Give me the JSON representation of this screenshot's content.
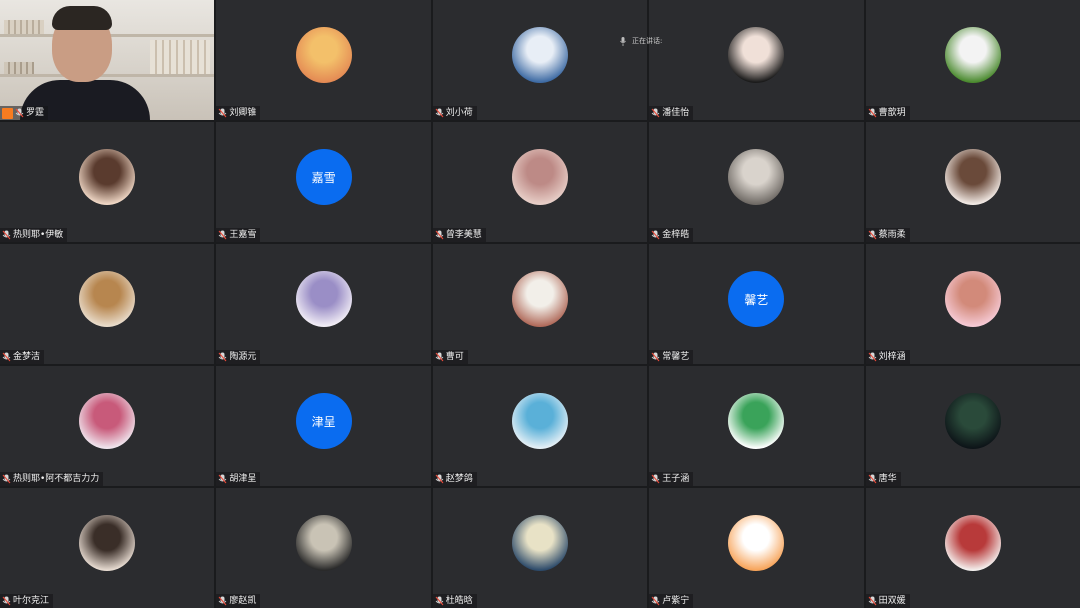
{
  "meeting": {
    "speaking_label": "正在讲话:"
  },
  "participants": [
    {
      "name": "罗霆",
      "type": "video",
      "host": true
    },
    {
      "name": "刘卿锥",
      "type": "image",
      "colors": [
        "#e48a54",
        "#f3c06a"
      ]
    },
    {
      "name": "刘小荷",
      "type": "image",
      "colors": [
        "#3d6aa3",
        "#e8eef6"
      ]
    },
    {
      "name": "潘佳怡",
      "type": "image",
      "colors": [
        "#1b1b1b",
        "#f0e0d8"
      ]
    },
    {
      "name": "曹歆玥",
      "type": "image",
      "colors": [
        "#4a8a2e",
        "#f3f3f3"
      ]
    },
    {
      "name": "热则耶•伊敏",
      "type": "image",
      "colors": [
        "#f0d8c6",
        "#5a3b2e"
      ]
    },
    {
      "name": "王嘉雪",
      "type": "text",
      "initials": "嘉雪",
      "bg": "#0a6cf0"
    },
    {
      "name": "曾李美慧",
      "type": "image",
      "colors": [
        "#e8cfc8",
        "#bd8a86"
      ]
    },
    {
      "name": "金梓皓",
      "type": "image",
      "colors": [
        "#6f6a65",
        "#d9d3cc"
      ]
    },
    {
      "name": "蔡雨柔",
      "type": "image",
      "colors": [
        "#f3ebe6",
        "#6a4a3a"
      ]
    },
    {
      "name": "金梦洁",
      "type": "image",
      "colors": [
        "#e9dccb",
        "#b7864f"
      ]
    },
    {
      "name": "陶源元",
      "type": "image",
      "colors": [
        "#f2eef6",
        "#9a8ec6"
      ]
    },
    {
      "name": "曹可",
      "type": "image",
      "colors": [
        "#b06a5a",
        "#f2efe9"
      ]
    },
    {
      "name": "常馨艺",
      "type": "text",
      "initials": "馨艺",
      "bg": "#0a6cf0"
    },
    {
      "name": "刘梓涵",
      "type": "image",
      "colors": [
        "#f6cad5",
        "#d28a7a"
      ]
    },
    {
      "name": "热则耶•阿不都吉力力",
      "type": "image",
      "colors": [
        "#f0e6ee",
        "#c85a7a"
      ]
    },
    {
      "name": "胡津呈",
      "type": "text",
      "initials": "津呈",
      "bg": "#0a6cf0"
    },
    {
      "name": "赵梦鸽",
      "type": "image",
      "colors": [
        "#e6f0f6",
        "#5ab0d8"
      ]
    },
    {
      "name": "王子涵",
      "type": "image",
      "colors": [
        "#ffffff",
        "#3aa35a"
      ]
    },
    {
      "name": "唐华",
      "type": "image",
      "colors": [
        "#0d1418",
        "#2a4a3a"
      ]
    },
    {
      "name": "叶尔克江",
      "type": "image",
      "colors": [
        "#e8dcd2",
        "#3a2e28"
      ]
    },
    {
      "name": "廖赵凯",
      "type": "image",
      "colors": [
        "#2a2a2a",
        "#c9c3b5"
      ]
    },
    {
      "name": "杜皓晗",
      "type": "image",
      "colors": [
        "#2c4a6a",
        "#e8e2c6"
      ]
    },
    {
      "name": "卢紫宁",
      "type": "image",
      "colors": [
        "#f7a45a",
        "#ffffff"
      ]
    },
    {
      "name": "田双媛",
      "type": "image",
      "colors": [
        "#f4f0ee",
        "#b83a3a"
      ]
    }
  ],
  "icons": {
    "mic_muted": "mic-muted-icon",
    "host": "host-icon",
    "mic": "mic-icon"
  }
}
